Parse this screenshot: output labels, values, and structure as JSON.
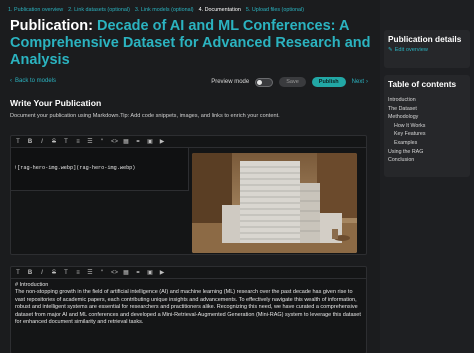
{
  "steps": [
    {
      "label": "1. Publication overview",
      "state": "done"
    },
    {
      "label": "2. Link datasets (optional)",
      "state": "done"
    },
    {
      "label": "3. Link models (optional)",
      "state": "done"
    },
    {
      "label": "4. Documentation",
      "state": "current"
    },
    {
      "label": "5. Upload files (optional)",
      "state": "todo"
    }
  ],
  "title": {
    "lead": "Publication:",
    "rest": "Decade of AI and ML Conferences: A Comprehensive Dataset for Advanced Research and Analysis"
  },
  "nav": {
    "back_label": "Back to models",
    "preview_label": "Preview mode",
    "save_label": "Save",
    "publish_label": "Publish",
    "next_label": "Next"
  },
  "section": {
    "heading": "Write Your Publication",
    "subtitle": "Document your publication using Markdown.Tip: Add code snippets, images, and links to enrich your content."
  },
  "editor1": {
    "code": "![rag-hero-img.webp](rag-hero-img.webp)"
  },
  "editor2": {
    "heading_line": "# Introduction",
    "paragraph": "The non-stopping growth in the field of artificial intelligence (AI) and machine learning (ML) research over the past decade has given rise to vast repositories of academic papers, each contributing unique insights and advancements. To effectively navigate this wealth of information, robust and intelligent systems are essential for researchers and practitioners alike. Recognizing this need, we have curated a comprehensive dataset from major AI and ML conferences and developed a Mini-Retrieval-Augmented Generation (Mini-RAG) system to leverage this dataset for enhanced document similarity and retrieval tasks."
  },
  "sidebar": {
    "details_heading": "Publication details",
    "edit_overview": "Edit overview",
    "toc_heading": "Table of contents",
    "toc": [
      {
        "label": "Introduction",
        "level": 1
      },
      {
        "label": "The Dataset",
        "level": 1
      },
      {
        "label": "Methodology",
        "level": 1
      },
      {
        "label": "How It Works",
        "level": 2
      },
      {
        "label": "Key Features",
        "level": 2
      },
      {
        "label": "Examples",
        "level": 2
      },
      {
        "label": "Using the RAG",
        "level": 1
      },
      {
        "label": "Conclusion",
        "level": 1
      }
    ]
  },
  "colors": {
    "accent": "#2bb3c0",
    "publish": "#22a7a5",
    "background": "#1b1c1e"
  },
  "icons": [
    "chevron-left-icon",
    "chevron-right-icon",
    "edit-icon",
    "bold-icon",
    "italic-icon",
    "heading-icon",
    "strikethrough-icon",
    "quote-icon",
    "code-icon",
    "table-icon",
    "link-icon",
    "image-icon",
    "video-icon"
  ]
}
